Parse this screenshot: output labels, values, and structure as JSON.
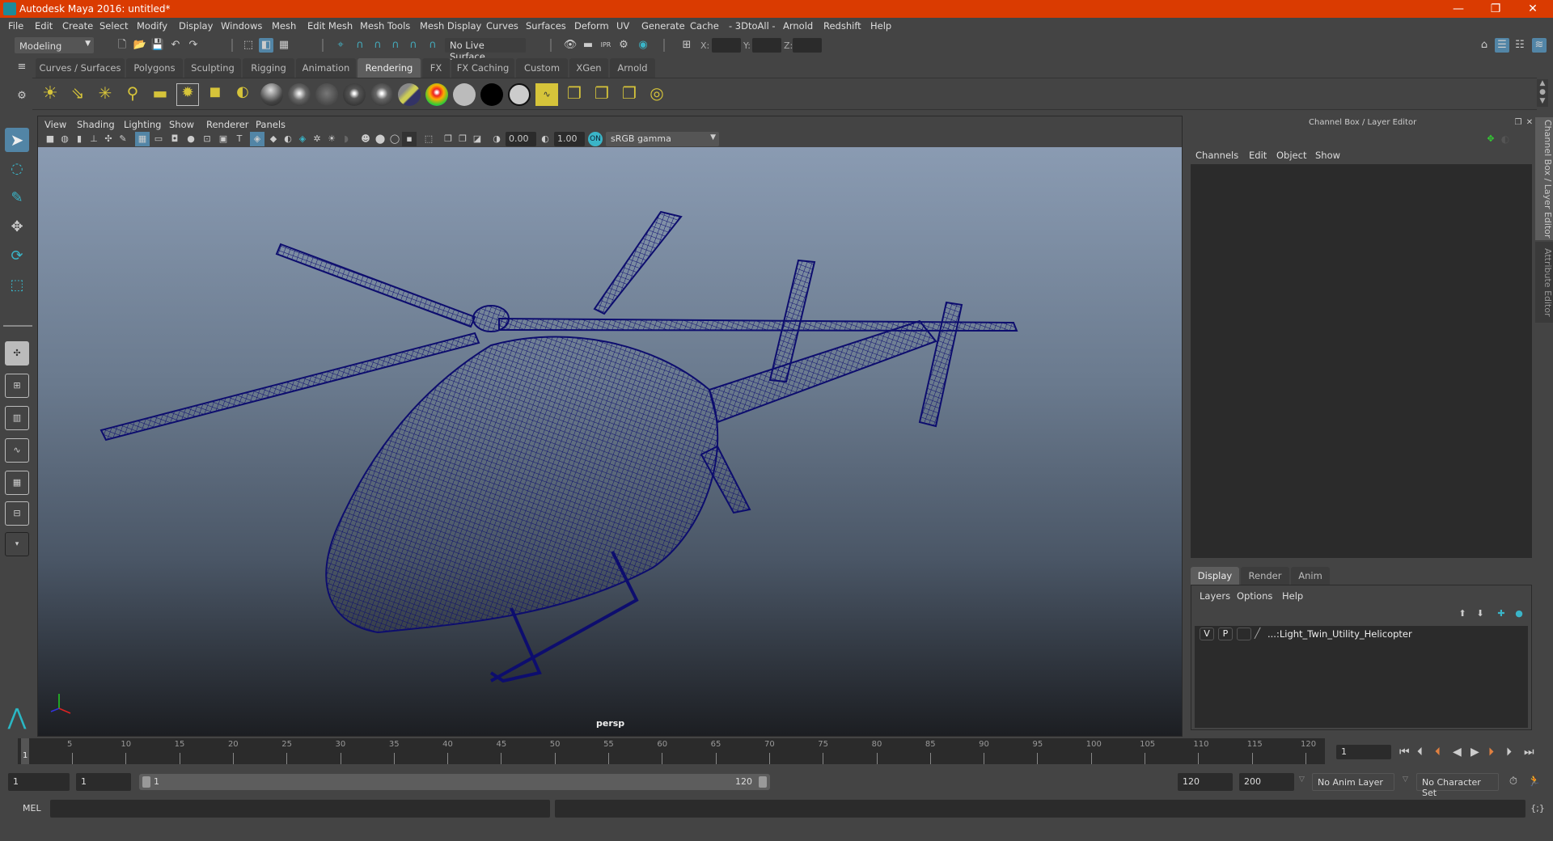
{
  "window": {
    "title": "Autodesk Maya 2016: untitled*",
    "controls": {
      "minimize": "—",
      "restore": "❐",
      "close": "✕"
    }
  },
  "menubar": [
    "File",
    "Edit",
    "Create",
    "Select",
    "Modify",
    "Display",
    "Windows",
    "Mesh",
    "Edit Mesh",
    "Mesh Tools",
    "Mesh Display",
    "Curves",
    "Surfaces",
    "Deform",
    "UV",
    "Generate",
    "Cache",
    "- 3DtoAll -",
    "Arnold",
    "Redshift",
    "Help"
  ],
  "statusline": {
    "mode": "Modeling",
    "live_surface": "No Live Surface",
    "x_label": "X:",
    "y_label": "Y:",
    "z_label": "Z:",
    "x_value": "",
    "y_value": "",
    "z_value": ""
  },
  "shelf": {
    "tabs": [
      "Curves / Surfaces",
      "Polygons",
      "Sculpting",
      "Rigging",
      "Animation",
      "Rendering",
      "FX",
      "FX Caching",
      "Custom",
      "XGen",
      "Arnold"
    ],
    "active_tab": "Rendering",
    "icons": [
      "ambient-light-icon",
      "directional-light-icon",
      "point-light-icon",
      "spot-light-icon",
      "area-light-icon",
      "volume-light-icon",
      "light-manipulator-icon",
      "hypershade-connect-icon",
      "anisotropic-material-icon",
      "blinn-material-icon",
      "lambert-material-icon",
      "phong-material-icon",
      "phonge-material-icon",
      "layered-shader-icon",
      "ramp-shader-icon",
      "surface-shader-gray-icon",
      "surface-shader-black-icon",
      "surface-shader-white-icon",
      "render-sequence-icon",
      "render-view-icon",
      "make-light-link-icon",
      "break-light-link-icon",
      "select-objects-illuminated-icon"
    ]
  },
  "viewport": {
    "menus": [
      "View",
      "Shading",
      "Lighting",
      "Show",
      "Renderer",
      "Panels"
    ],
    "exposure": "0.00",
    "gamma": "1.00",
    "color_space": "sRGB gamma",
    "camera_label": "persp",
    "bg_top": "#8a9bb2",
    "bg_bottom": "#1c1e22",
    "wire_color": "#0d0d6e"
  },
  "channelbox": {
    "title": "Channel Box / Layer Editor",
    "menus": [
      "Channels",
      "Edit",
      "Object",
      "Show"
    ]
  },
  "layereditor": {
    "tabs": [
      "Display",
      "Render",
      "Anim"
    ],
    "active_tab": "Display",
    "menus": [
      "Layers",
      "Options",
      "Help"
    ],
    "layers": [
      {
        "visible": "V",
        "playback": "P",
        "name": "...:Light_Twin_Utility_Helicopter"
      }
    ]
  },
  "sidetabs": [
    "Channel Box / Layer Editor",
    "Attribute Editor"
  ],
  "timeline": {
    "ticks": [
      "5",
      "10",
      "15",
      "20",
      "25",
      "30",
      "35",
      "40",
      "45",
      "50",
      "55",
      "60",
      "65",
      "70",
      "75",
      "80",
      "85",
      "90",
      "95",
      "100",
      "105",
      "110",
      "115",
      "120"
    ],
    "current_frame_marker": "1",
    "current_frame": "1"
  },
  "range": {
    "start": "1",
    "playback_start": "1",
    "range_start_label": "1",
    "range_end_label": "120",
    "playback_end": "120",
    "end": "200",
    "anim_layer": "No Anim Layer",
    "character_set": "No Character Set"
  },
  "cmdline": {
    "label": "MEL",
    "value": "",
    "result": ""
  }
}
